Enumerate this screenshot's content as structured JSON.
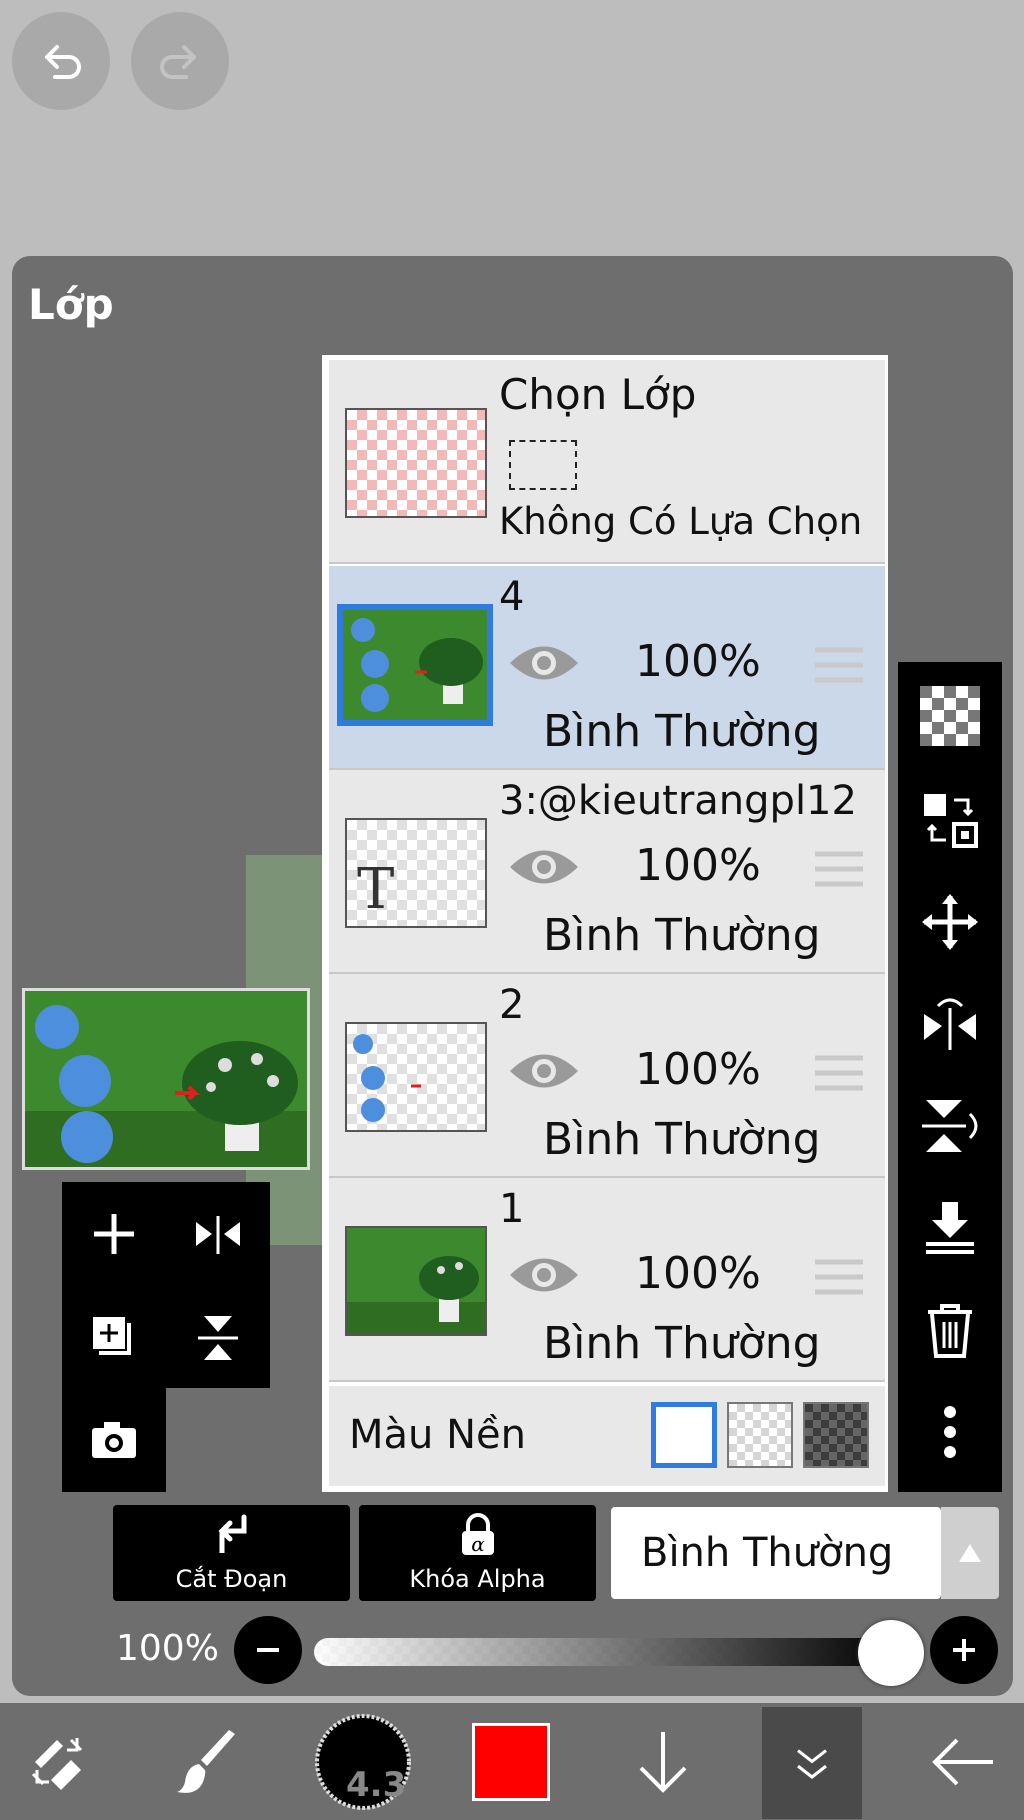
{
  "panel": {
    "title": "Lớp"
  },
  "selection": {
    "title": "Chọn Lớp",
    "status": "Không Có Lựa Chọn"
  },
  "layers": [
    {
      "name": "4",
      "opacity": "100%",
      "mode": "Bình Thường",
      "active": true
    },
    {
      "name": "3:@kieutrangpl12",
      "opacity": "100%",
      "mode": "Bình Thường",
      "active": false
    },
    {
      "name": "2",
      "opacity": "100%",
      "mode": "Bình Thường",
      "active": false
    },
    {
      "name": "1",
      "opacity": "100%",
      "mode": "Bình Thường",
      "active": false
    }
  ],
  "background": {
    "label": "Màu Nền",
    "options": [
      "white",
      "transparent",
      "dark"
    ],
    "selected": "white"
  },
  "actions": {
    "clip_label": "Cắt Đoạn",
    "alpha_lock_label": "Khóa Alpha"
  },
  "blend_mode": {
    "value": "Bình Thường"
  },
  "opacity_slider": {
    "label": "100%",
    "value": 1.0
  },
  "brush": {
    "size": "4.3"
  },
  "colors": {
    "accent": "#2f7be0",
    "current_color": "#ff0000",
    "active_row": "#cbd8ea"
  },
  "icons": [
    "undo-icon",
    "redo-icon",
    "add-layer-icon",
    "flip-horizontal-icon",
    "duplicate-layer-icon",
    "flip-vertical-icon",
    "camera-icon",
    "checker-icon",
    "transfer-icon",
    "move-icon",
    "merge-down-icon",
    "trash-icon",
    "more-icon",
    "eye-icon",
    "drag-handle-icon",
    "clip-arrow-icon",
    "alpha-lock-icon"
  ]
}
